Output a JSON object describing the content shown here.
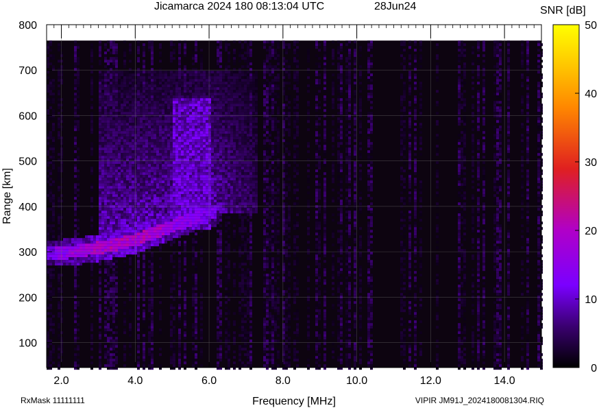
{
  "header": {
    "title": "Jicamarca 2024 180 08:13:04 UTC",
    "date": "28Jun24"
  },
  "footer": {
    "rx_mask": "RxMask 11111111",
    "file_label": "VIPIR  JM91J_2024180081304.RIQ"
  },
  "chart_data": {
    "type": "heatmap",
    "title": "Jicamarca 2024 180 08:13:04 UTC",
    "subtitle": "28Jun24",
    "xlabel": "Frequency [MHz]",
    "ylabel": "Range [km]",
    "xlim": [
      1.6,
      15.0
    ],
    "ylim": [
      45,
      800
    ],
    "x_ticks": [
      2.0,
      4.0,
      6.0,
      8.0,
      10.0,
      12.0,
      14.0
    ],
    "x_tick_labels": [
      "2.0",
      "4.0",
      "6.0",
      "8.0",
      "10.0",
      "12.0",
      "14.0"
    ],
    "y_ticks": [
      100,
      200,
      300,
      400,
      500,
      600,
      700,
      800
    ],
    "y_tick_labels": [
      "100",
      "200",
      "300",
      "400",
      "500",
      "600",
      "700",
      "800"
    ],
    "grid": true,
    "colorbar": {
      "label": "SNR [dB]",
      "range": [
        0,
        50
      ],
      "ticks": [
        0,
        10,
        20,
        30,
        40,
        50
      ],
      "tick_labels": [
        "0",
        "10",
        "20",
        "30",
        "40",
        "50"
      ],
      "colors": [
        "#000000",
        "#3a0070",
        "#7a00ff",
        "#b000c8",
        "#e02020",
        "#ff8800",
        "#ffd000",
        "#ffff00"
      ]
    },
    "data_range_top_km": 765,
    "trace_points": [
      {
        "f": 1.6,
        "h": 300,
        "snr": 12
      },
      {
        "f": 2.0,
        "h": 300,
        "snr": 16
      },
      {
        "f": 2.5,
        "h": 305,
        "snr": 18
      },
      {
        "f": 3.0,
        "h": 312,
        "snr": 20
      },
      {
        "f": 3.5,
        "h": 320,
        "snr": 21
      },
      {
        "f": 4.0,
        "h": 330,
        "snr": 21
      },
      {
        "f": 4.5,
        "h": 345,
        "snr": 20
      },
      {
        "f": 5.0,
        "h": 360,
        "snr": 17
      },
      {
        "f": 5.5,
        "h": 375,
        "snr": 15
      },
      {
        "f": 6.0,
        "h": 390,
        "snr": 13
      }
    ],
    "spread_f_region": {
      "f_min": 3.0,
      "f_max": 7.3,
      "h_min": 310,
      "h_max": 700,
      "snr": 11
    }
  }
}
